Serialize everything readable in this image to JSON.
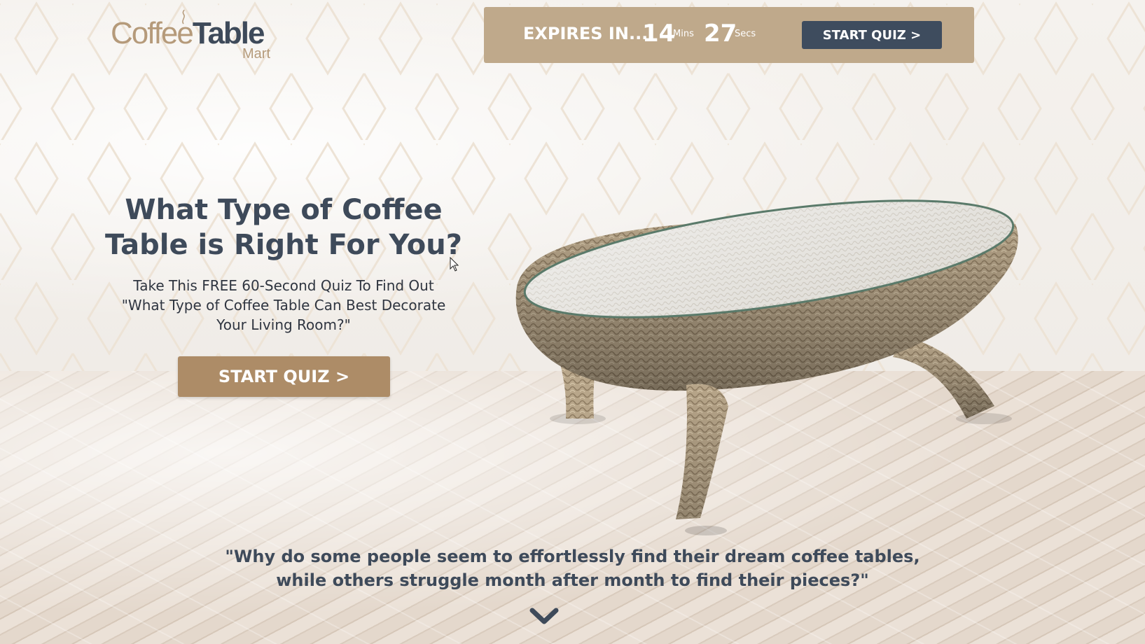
{
  "logo": {
    "coffee": "Coffee",
    "table": "Table",
    "mart": "Mart"
  },
  "timer": {
    "expires_label": "EXPIRES IN...",
    "minutes": "14",
    "minutes_unit": "Mins",
    "seconds": "27",
    "seconds_unit": "Secs",
    "button_label": "START QUIZ >"
  },
  "hero": {
    "title": "What Type of Coffee Table is Right For You?",
    "subtitle": "Take This FREE 60-Second Quiz To Find Out \"What Type of Coffee Table Can Best Decorate Your Living Room?\"",
    "button_label": "START QUIZ >"
  },
  "quote": {
    "text": "\"Why do some people seem to effortlessly find their dream coffee tables, while others struggle month after month to find their pieces?\""
  },
  "icons": {
    "scroll_down": "chevron-down-icon",
    "cursor": "mouse-pointer-icon",
    "steam": "steam-icon"
  },
  "colors": {
    "brand_tan": "#bfa98b",
    "button_tan": "#ad8c67",
    "navy": "#3e4c5e",
    "heading": "#3e4a5a"
  }
}
